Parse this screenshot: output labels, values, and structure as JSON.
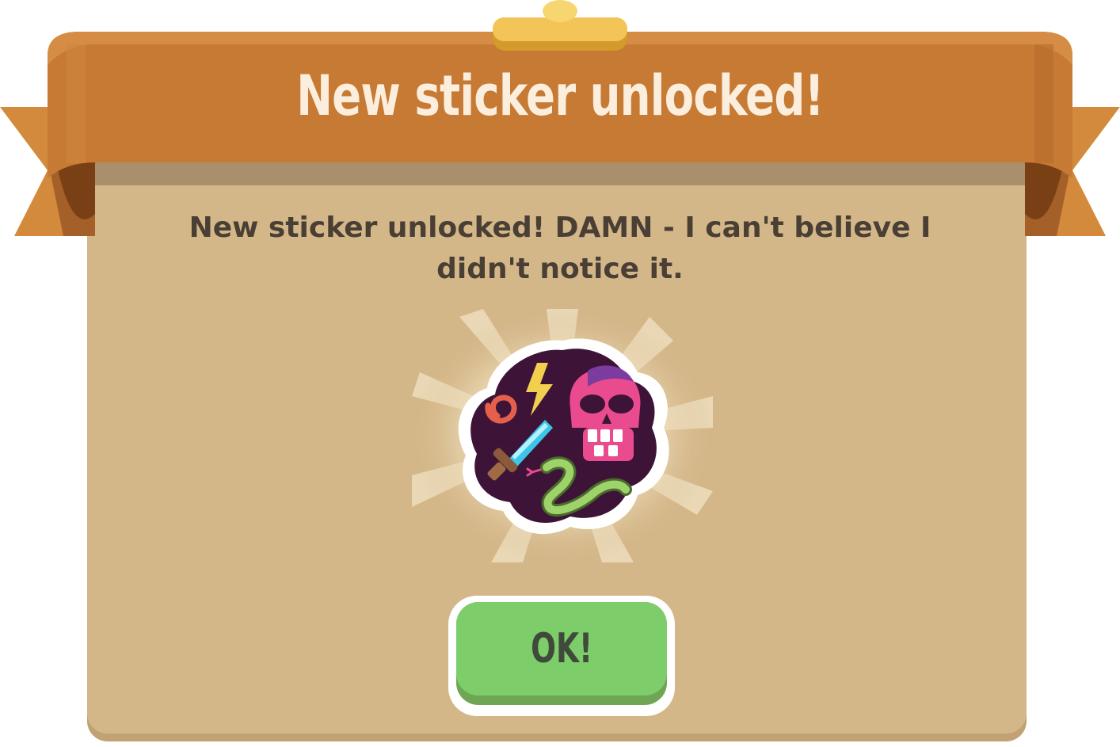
{
  "dialog": {
    "title": "New sticker unlocked!",
    "message_line1": "New sticker unlocked! DAMN - I can't believe I",
    "message_line2": "didn't notice it.",
    "ok_label": "OK!"
  },
  "sticker": {
    "icons": [
      "spiral-icon",
      "lightning-icon",
      "skull-icon",
      "sword-icon",
      "snake-icon"
    ]
  },
  "colors": {
    "ribbon": "#c77a34",
    "parchment": "#d4b789",
    "button_green": "#7dcd6b",
    "sticker_bg": "#3d1438"
  }
}
